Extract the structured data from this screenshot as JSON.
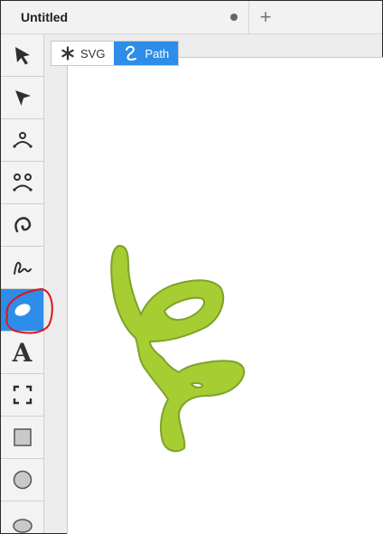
{
  "tab": {
    "title": "Untitled"
  },
  "new_tab_symbol": "+",
  "toolbar": {
    "tools": [
      {
        "name": "select",
        "icon": "arrow-pointer-icon"
      },
      {
        "name": "direct-select",
        "icon": "direct-select-arrow-icon"
      },
      {
        "name": "node-tool",
        "icon": "node-person-icon"
      },
      {
        "name": "node-edit",
        "icon": "nodes-sad-face-icon"
      },
      {
        "name": "spiral",
        "icon": "spiral-icon"
      },
      {
        "name": "freehand",
        "icon": "squiggle-icon"
      },
      {
        "name": "ellipse-brush",
        "icon": "ellipse-brush-icon",
        "active": true
      },
      {
        "name": "text",
        "icon": "text-icon",
        "label": "A"
      },
      {
        "name": "crop",
        "icon": "crop-frame-icon"
      },
      {
        "name": "rectangle",
        "icon": "square-icon"
      },
      {
        "name": "circle",
        "icon": "circle-icon"
      },
      {
        "name": "ellipse",
        "icon": "ellipse-icon"
      }
    ]
  },
  "mode_switch": {
    "svg_label": "SVG",
    "path_label": "Path",
    "active": "Path"
  },
  "colors": {
    "accent": "#2d8de8",
    "shape_fill": "#a6cd32",
    "shape_stroke": "#7ea22a",
    "annotation": "#e0141e"
  }
}
